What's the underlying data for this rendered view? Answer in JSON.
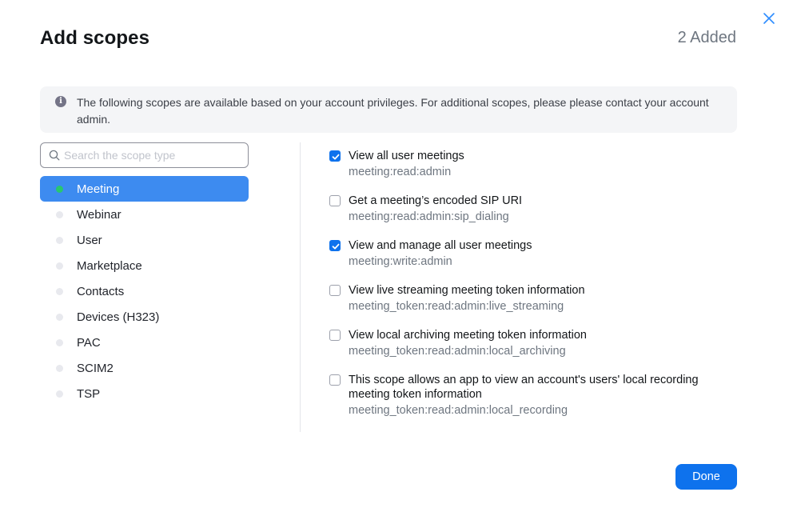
{
  "dialog": {
    "title": "Add scopes",
    "added_count": "2 Added",
    "info_text": "The following scopes are available based on your account privileges. For additional scopes, please please contact your account admin.",
    "done_label": "Done"
  },
  "search": {
    "placeholder": "Search the scope type",
    "value": ""
  },
  "categories": [
    {
      "label": "Meeting",
      "active": true
    },
    {
      "label": "Webinar",
      "active": false
    },
    {
      "label": "User",
      "active": false
    },
    {
      "label": "Marketplace",
      "active": false
    },
    {
      "label": "Contacts",
      "active": false
    },
    {
      "label": "Devices (H323)",
      "active": false
    },
    {
      "label": "PAC",
      "active": false
    },
    {
      "label": "SCIM2",
      "active": false
    },
    {
      "label": "TSP",
      "active": false
    }
  ],
  "scopes": [
    {
      "title": "View all user meetings",
      "code": "meeting:read:admin",
      "checked": true
    },
    {
      "title": "Get a meeting’s encoded SIP URI",
      "code": "meeting:read:admin:sip_dialing",
      "checked": false
    },
    {
      "title": "View and manage all user meetings",
      "code": "meeting:write:admin",
      "checked": true
    },
    {
      "title": "View live streaming meeting token information",
      "code": "meeting_token:read:admin:live_streaming",
      "checked": false
    },
    {
      "title": "View local archiving meeting token information",
      "code": "meeting_token:read:admin:local_archiving",
      "checked": false
    },
    {
      "title": "This scope allows an app to view an account's users' local recording meeting token information",
      "code": "meeting_token:read:admin:local_recording",
      "checked": false
    }
  ],
  "colors": {
    "primary": "#0e72ed",
    "active_category": "#3d8bf0",
    "active_dot": "#28c76f"
  }
}
